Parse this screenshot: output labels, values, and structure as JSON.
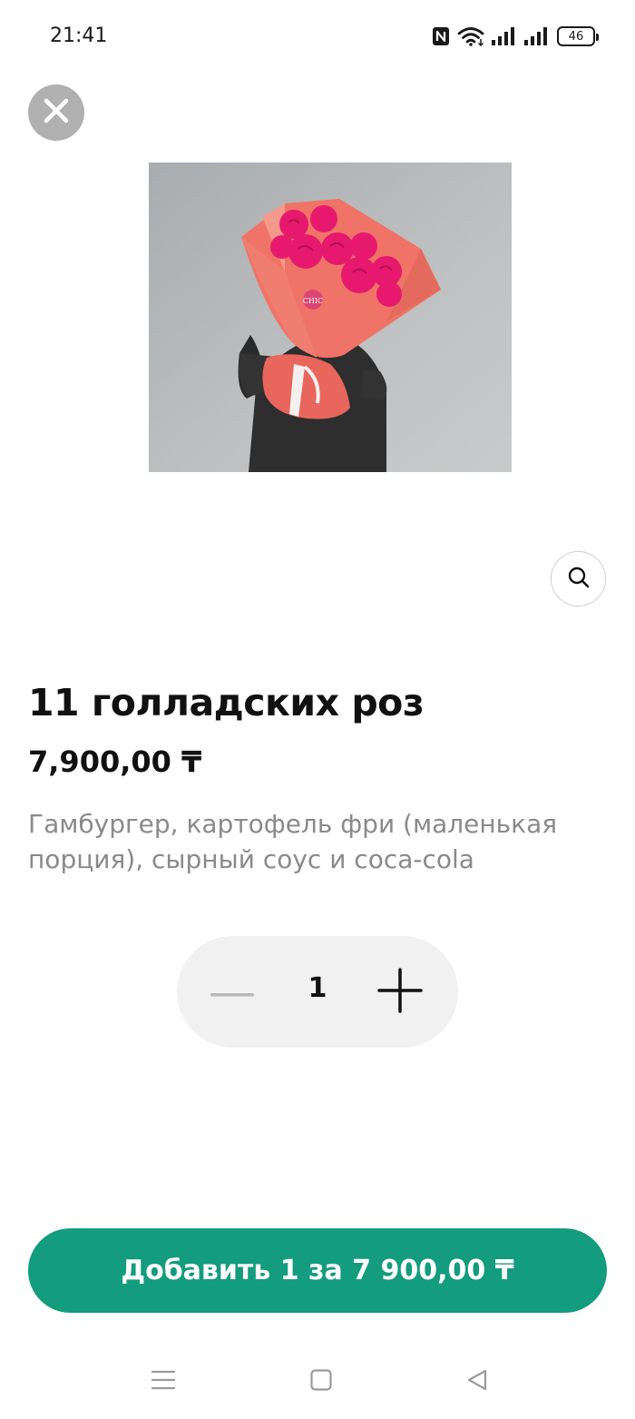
{
  "status_bar": {
    "time": "21:41",
    "battery": "46",
    "icons": [
      "nfc-icon",
      "wifi-icon",
      "signal-icon",
      "signal-icon",
      "battery-icon"
    ]
  },
  "close_button": {
    "icon": "close-icon"
  },
  "product": {
    "image_label": "CHIC",
    "title": "11 голладских роз",
    "price": "7,900,00 ₸",
    "description": "Гамбургер, картофель фри (маленькая порция), сырный соус и coca-cola"
  },
  "zoom_button": {
    "icon": "search-icon"
  },
  "quantity": {
    "value": "1",
    "minus_icon": "minus-icon",
    "plus_icon": "plus-icon"
  },
  "add_button": {
    "label": "Добавить 1 за 7 900,00 ₸"
  },
  "nav": {
    "icons": [
      "menu-icon",
      "home-icon",
      "back-icon"
    ]
  },
  "colors": {
    "accent": "#139c7e",
    "close_bg": "#b0b0b0",
    "stepper_bg": "#f1f1f1",
    "description": "#8a8a8a"
  }
}
